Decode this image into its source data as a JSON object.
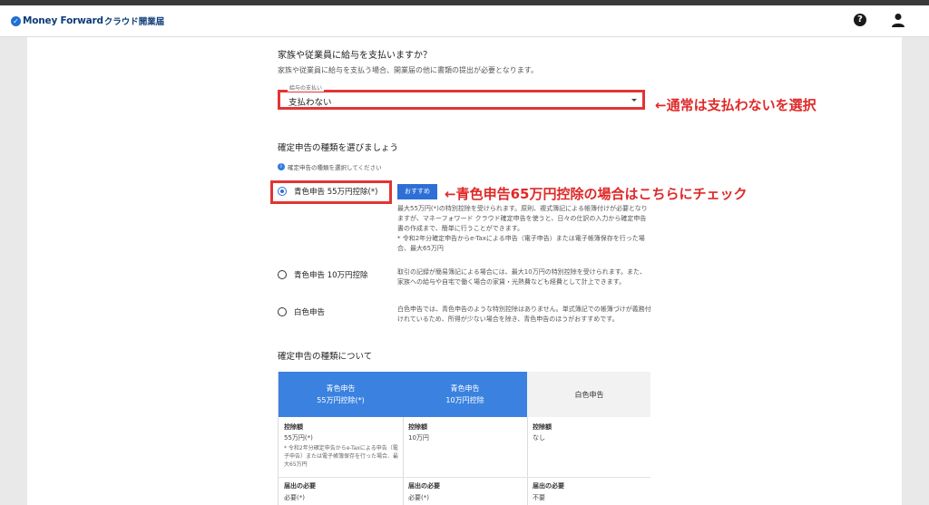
{
  "header": {
    "brand": "Money Forward",
    "product": "クラウド開業届",
    "help_glyph": "?"
  },
  "salary": {
    "question": "家族や従業員に給与を支払いますか？",
    "description": "家族や従業員に給与を支払う場合、開業届の他に書類の提出が必要となります。",
    "field_label": "給与の支払い",
    "selected": "支払わない",
    "annotation": "←通常は支払わないを選択"
  },
  "filing": {
    "heading": "確定申告の種類を選びましょう",
    "hint": "確定申告の種類を選択してください",
    "annotation": "←青色申告65万円控除の場合はこちらにチェック",
    "options": [
      {
        "label": "青色申告 55万円控除(*)",
        "badge": "おすすめ",
        "selected": true,
        "desc": "最大55万円(*)の特別控除を受けられます。原則、複式簿記による帳簿付けが必要となりますが、マネーフォワード クラウド確定申告を使うと、日々の仕訳の入力から確定申告書の作成まで、簡単に行うことができます。",
        "note": "* 令和2年分確定申告からe-Taxによる申告（電子申告）または電子帳簿保存を行った場合、最大65万円"
      },
      {
        "label": "青色申告 10万円控除",
        "selected": false,
        "desc": "取引の記録が簡易簿記による場合には、最大10万円の特別控除を受けられます。また、家族への給与や自宅で働く場合の家賃・光熱費なども経費として計上できます。"
      },
      {
        "label": "白色申告",
        "selected": false,
        "desc": "白色申告では、青色申告のような特別控除はありません。単式簿記での帳簿づけが義務付けれているため、所得が少ない場合を除き、青色申告のほうがおすすめです。"
      }
    ]
  },
  "comparison": {
    "heading": "確定申告の種類について",
    "deduction_label": "控除額",
    "notice_label": "届出の必要",
    "columns": [
      {
        "head1": "青色申告",
        "head2": "55万円控除(*)",
        "deduction": "55万円(*)",
        "deduction_note": "* 令和2年分確定申告からe-Taxによる申告（電子申告）または電子帳簿保存を行った場合、最大65万円",
        "notice": "必要(*)"
      },
      {
        "head1": "青色申告",
        "head2": "10万円控除",
        "deduction": "10万円",
        "deduction_note": "",
        "notice": "必要(*)"
      },
      {
        "head1": "白色申告",
        "head2": "",
        "deduction": "なし",
        "deduction_note": "",
        "notice": "不要"
      }
    ]
  },
  "colors": {
    "accent_blue": "#2e6fd6",
    "highlight_red": "#e33434",
    "annotation_red": "#e02828",
    "header_blue": "#3b82e0"
  }
}
